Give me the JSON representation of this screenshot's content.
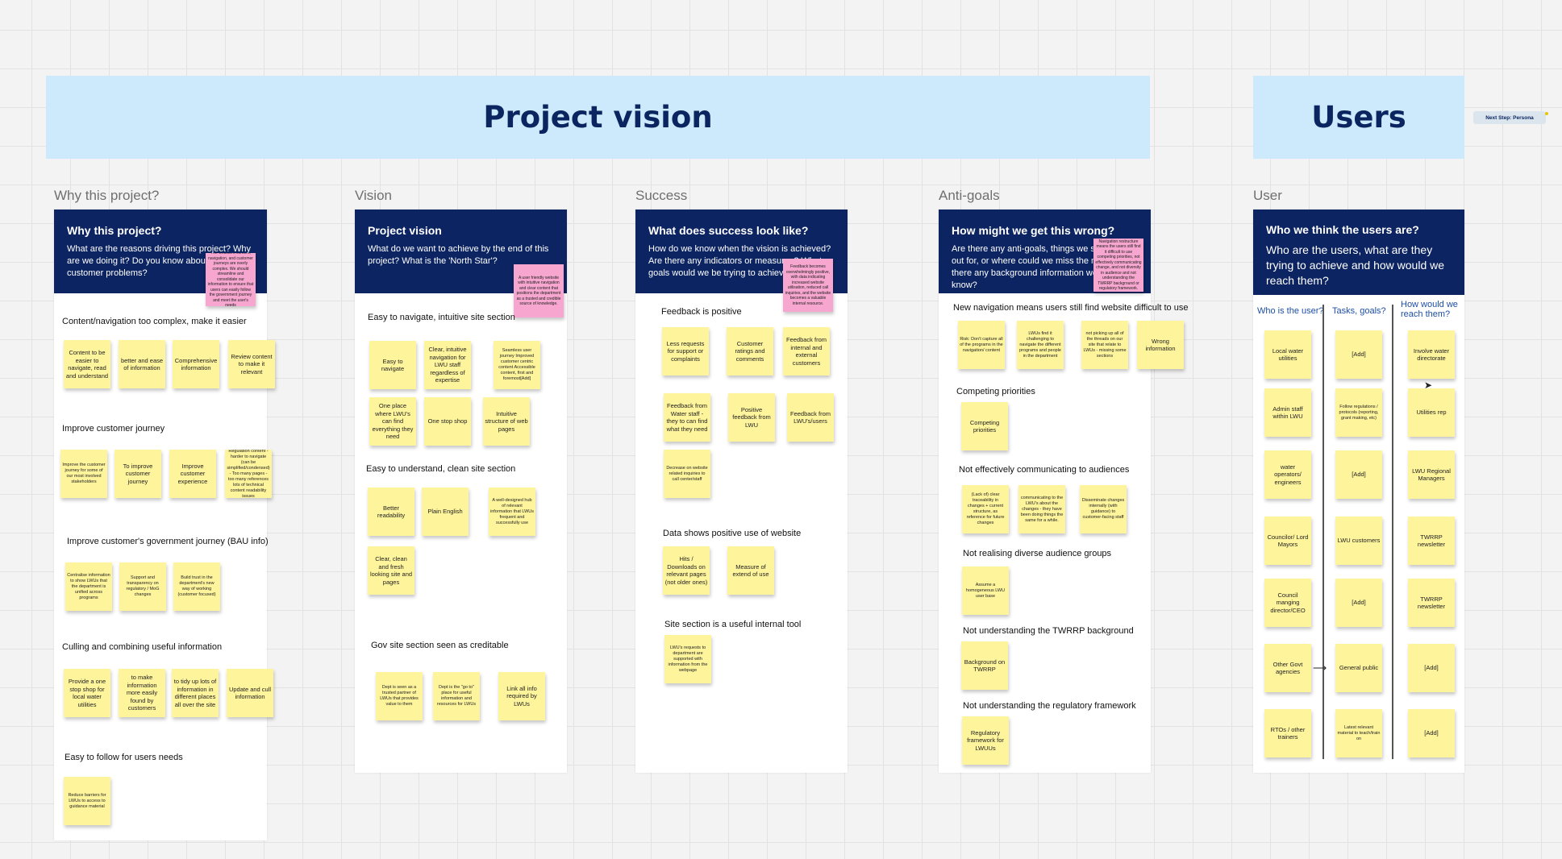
{
  "banners": {
    "project_vision": "Project vision",
    "users": "Users"
  },
  "next_step": "Next Step: Persona",
  "labels": {
    "why": "Why this project?",
    "vision": "Vision",
    "success": "Success",
    "anti": "Anti-goals",
    "user": "User"
  },
  "why": {
    "title": "Why this project?",
    "sub": "What are the reasons driving this project? Why are we doing it? Do you know about any customer problems?",
    "pink": "The website's content, navigation, and customer journeys are overly complex. We should streamline and consolidate our information to ensure that users can easily follow the government journey and meet the user's needs",
    "sections": [
      "Content/navigation too complex, make it easier",
      "Improve customer journey",
      "Improve customer's government journey (BAU info)",
      "Culling and combining useful information",
      "Easy to follow for users needs"
    ],
    "s1": [
      "Content to be easier to navigate, read and understand",
      "better and ease of information",
      "Comprehensive information",
      "Review content to make it relevant"
    ],
    "s2": [
      "Improve the customer journey for some of our most involved stakeholders",
      "To improve customer journey",
      "Improve customer experience",
      "Regulation content - harder to navigate (can be simplified/condensed) - Too many pages - too many references lots of technical content readability issues"
    ],
    "s3": [
      "Centralise information to show LWUs that the department is unified across programs",
      "Support and transparency on regulatory / MoG changes",
      "Build trust in the department's new way of working (customer focused)"
    ],
    "s4": [
      "Provide a one stop shop for local water utilities",
      "to make information more easily found by customers",
      "to tidy up lots of information in different places all over the site",
      "Update and cull information"
    ],
    "s5": [
      "Reduce barriers for LWUs to access to guidance material"
    ]
  },
  "vision": {
    "title": "Project vision",
    "sub": "What do we want to achieve by the end of this project? What is the 'North Star'?",
    "pink": "A user friendly website with intuitive navigation and clear content that positions the department as a trusted and credible source of knowledge.",
    "sections": [
      "Easy to navigate, intuitive site section",
      "Easy to understand, clean site section",
      "Gov site section seen as creditable"
    ],
    "s1": [
      "Easy to navigate",
      "Clear, intuitive navigation for LWU staff regardless of expertise",
      "Seamless user journey Improved customer centric content Accessible content, first and foremost[Add]",
      "One place where LWU's can find everything they need",
      "One stop shop",
      "Intuitive structure of web pages"
    ],
    "s2": [
      "Better readability",
      "Plain English",
      "A well-designed hub of relevant information that LWUs frequent and successfully use",
      "Clear, clean and fresh looking site and pages"
    ],
    "s3": [
      "Dept is seen as a trusted partner of LWUs that provides value to them",
      "Dept is the \"go to\" place for useful information and resources for LWUs",
      "Link all info required by LWUs"
    ]
  },
  "success": {
    "title": "What does success look like?",
    "sub": "How do we know when the vision is achieved? Are there any indicators or measures? What goals would we be trying to achieve?",
    "pink": "Feedback becomes overwhelmingly positive, with data indicating increased website utilisation, reduced call inquiries, and the website becomes a valuable internal resource.",
    "sections": [
      "Feedback is positive",
      "Data shows positive use of website",
      "Site section is a useful internal tool"
    ],
    "s1": [
      "Less requests for support or complaints",
      "Customer ratings and comments",
      "Feedback from internal and external customers",
      "Feedback from Water staff - they to can find what they need",
      "Positive feedback from LWU",
      "Feedback from LWU's/users",
      "Decrease on website related inquiries to call center/staff"
    ],
    "s2": [
      "Hits / Downloads on relevant pages (not older ones)",
      "Measure of extend of use"
    ],
    "s3": [
      "LWU's requests to department are supported with information from the webpage"
    ]
  },
  "anti": {
    "title": "How might we get this wrong?",
    "sub": "Are there any anti-goals, things we should look out for, or where could we miss the mark? Is there any background information we should know?",
    "pink": "Navigation restructure means the users still find it difficult to use competing priorities, not effectively communicating change, and not diversity in audience and not understanding the TWRRP background or regulatory framework.",
    "sections": [
      "New navigation means users still find website difficult to use",
      "Competing priorities",
      "Not effectively communicating to audiences",
      "Not realising diverse audience groups",
      "Not understanding the TWRRP background",
      "Not understanding the regulatory framework"
    ],
    "s1": [
      "Risk: Don't capture all of the programs in the navigation/ content",
      "LWUs find it challenging to navigate the different programs and people in the department",
      "not picking up all of the threads on our site that relate to LWUs - missing some sections",
      "Wrong information"
    ],
    "s2": [
      "Competing priorities"
    ],
    "s3": [
      "(Lack of) clear traceability in changes + current structure, as reference for future changes",
      "communicating to the LWU's about the changes - they have been doing things the same for a while.",
      "Disseminate changes internally (with guidance) to customer-facing staff"
    ],
    "s4": [
      "Assume a homogeneous LWU user base"
    ],
    "s5": [
      "Background on TWRRP"
    ],
    "s6": [
      "Regulatory framework for LWUUs"
    ]
  },
  "users": {
    "title": "Who we think the users are?",
    "sub": "Who are the users, what are they trying to achieve and how would we reach them?",
    "cols": [
      "Who is the user?",
      "Tasks, goals?",
      "How would we reach them?"
    ],
    "who": [
      "Local water utilities",
      "Admin staff within LWU",
      "water operators/ engineers",
      "Councilor/ Lord Mayors",
      "Council manging director/CEO",
      "Other Govt agencies",
      "RTOs / other trainers"
    ],
    "tasks": [
      "[Add]",
      "Follow regulations / protocols (reporting, grant making, etc)",
      "[Add]",
      "LWU customers",
      "[Add]",
      "General public",
      "Latest relevant material to teach/train on"
    ],
    "reach": [
      "Involve water directorate",
      "Utilities rep",
      "LWU Regional Managers",
      "TWRRP newsletter",
      "TWRRP newsletter",
      "[Add]",
      "[Add]"
    ]
  }
}
